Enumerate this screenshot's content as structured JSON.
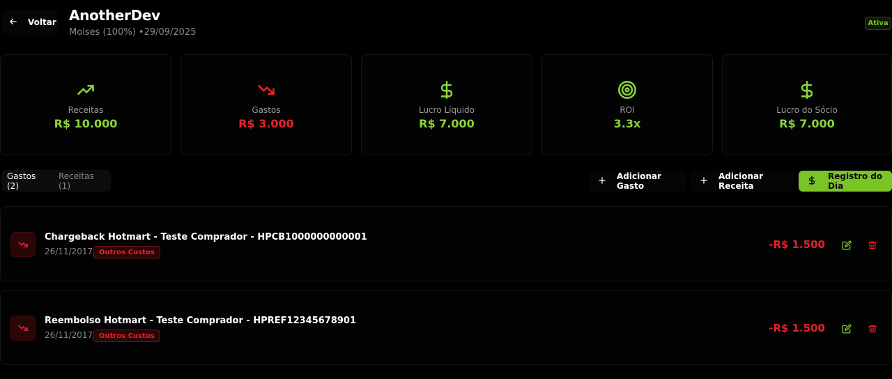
{
  "header": {
    "back_label": "Voltar",
    "title": "AnotherDev",
    "meta": "Moises (100%) •29/09/2025",
    "status": "Ativa"
  },
  "stats": [
    {
      "label": "Receitas",
      "value": "R$ 10.000",
      "icon": "trending-up-icon",
      "color": "#8bd33a"
    },
    {
      "label": "Gastos",
      "value": "R$ 3.000",
      "icon": "trending-down-icon",
      "color": "#e5222b"
    },
    {
      "label": "Lucro Líquido",
      "value": "R$ 7.000",
      "icon": "dollar-icon",
      "color": "#8bd33a"
    },
    {
      "label": "ROI",
      "value": "3.3x",
      "icon": "target-icon",
      "color": "#8bd33a"
    },
    {
      "label": "Lucro do Sócio",
      "value": "R$ 7.000",
      "icon": "dollar-icon",
      "color": "#8bd33a"
    }
  ],
  "tabs": {
    "gastos": "Gastos (2)",
    "receitas": "Receitas (1)"
  },
  "actions": {
    "add_expense": "Adicionar Gasto",
    "add_income": "Adicionar Receita",
    "daily_record": "Registro do Dia"
  },
  "expenses": [
    {
      "title": "Chargeback Hotmart - Teste Comprador - HPCB1000000000001",
      "date": "26/11/2017",
      "tag": "Outros Custos",
      "amount": "-R$ 1.500"
    },
    {
      "title": "Reembolso Hotmart - Teste Comprador - HPREF12345678901",
      "date": "26/11/2017",
      "tag": "Outros Custos",
      "amount": "-R$ 1.500"
    }
  ],
  "colors": {
    "accent": "#7ac428",
    "positive": "#8bd33a",
    "negative": "#e5222b",
    "background": "#000000"
  }
}
